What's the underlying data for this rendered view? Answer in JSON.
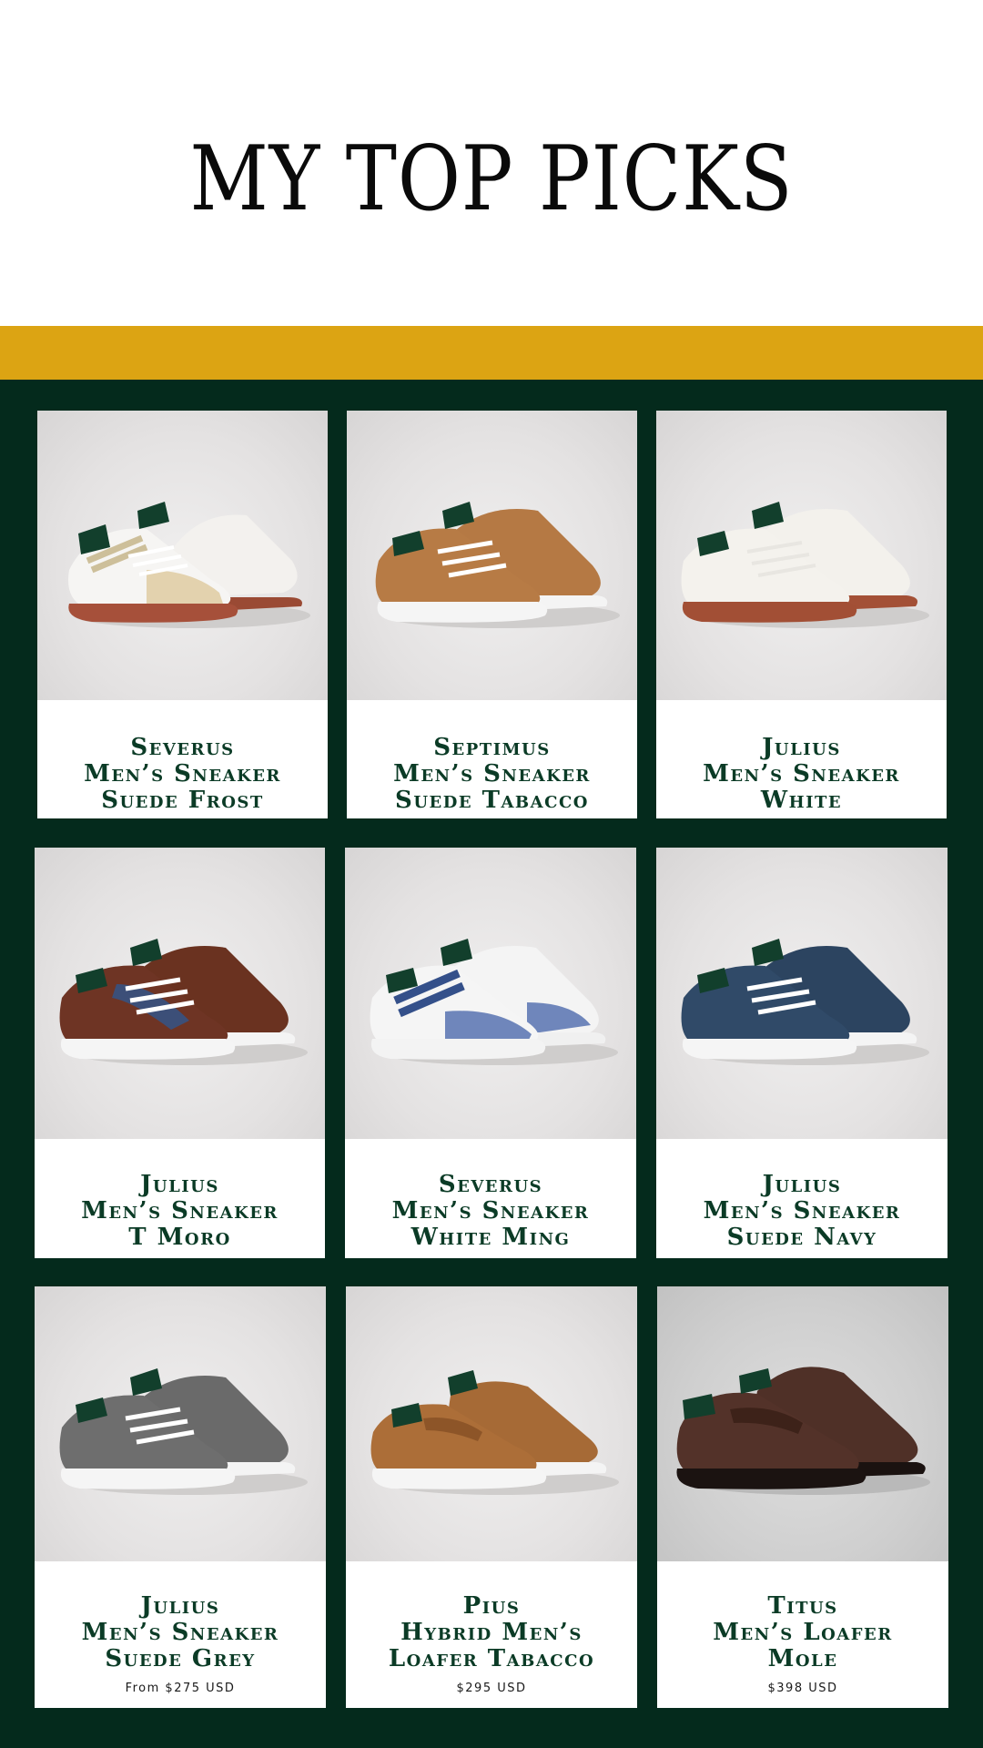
{
  "header": {
    "title": "MY TOP PICKS"
  },
  "colors": {
    "gold": "#dca413",
    "forest": "#042a1c",
    "caption": "#0b3b26"
  },
  "products": [
    {
      "lines": [
        "Severus",
        "Men’s Sneaker",
        "Suede Frost"
      ],
      "price": "",
      "icon": "sneaker-frost-icon"
    },
    {
      "lines": [
        "Septimus",
        "Men’s Sneaker",
        "Suede Tabacco"
      ],
      "price": "",
      "icon": "sneaker-tabacco-icon"
    },
    {
      "lines": [
        "Julius",
        "Men’s Sneaker",
        "White"
      ],
      "price": "",
      "icon": "sneaker-white-icon"
    },
    {
      "lines": [
        "Julius",
        "Men’s Sneaker",
        "T Moro"
      ],
      "price": "",
      "icon": "sneaker-tmoro-icon"
    },
    {
      "lines": [
        "Severus",
        "Men’s Sneaker",
        "White Ming"
      ],
      "price": "",
      "icon": "sneaker-whiteming-icon"
    },
    {
      "lines": [
        "Julius",
        "Men’s Sneaker",
        "Suede Navy"
      ],
      "price": "",
      "icon": "sneaker-navy-icon"
    },
    {
      "lines": [
        "Julius",
        "Men’s Sneaker",
        "Suede Grey"
      ],
      "price": "From $275 USD",
      "icon": "sneaker-grey-icon"
    },
    {
      "lines": [
        "Pius",
        "Hybrid Men’s",
        "Loafer Tabacco"
      ],
      "price": "$295 USD",
      "icon": "loafer-tabacco-icon"
    },
    {
      "lines": [
        "Titus",
        "Men’s Loafer",
        "Mole"
      ],
      "price": "$398 USD",
      "icon": "loafer-mole-icon"
    }
  ]
}
